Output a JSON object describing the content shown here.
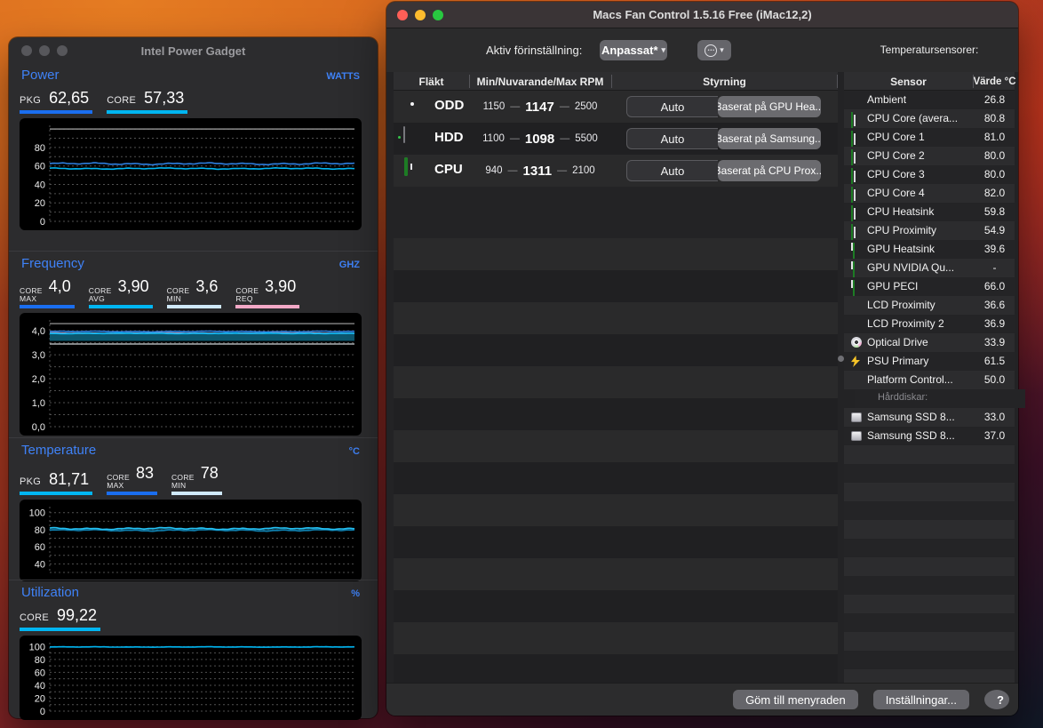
{
  "colors": {
    "accent_blue": "#3f82f7",
    "stat_blue": "#1a6ef0",
    "stat_cyan": "#00b6f2",
    "stat_pale_blue": "#cfe9fa",
    "stat_pink": "#f2a8c6",
    "traffic_red": "#ff5f57",
    "traffic_yellow": "#febc2e",
    "traffic_green": "#28c840"
  },
  "power_gadget": {
    "window_title": "Intel Power Gadget",
    "sections": {
      "power": {
        "title": "Power",
        "unit": "WATTS",
        "stats": [
          {
            "label": "PKG",
            "value": "62,65"
          },
          {
            "label": "CORE",
            "value": "57,33"
          }
        ]
      },
      "frequency": {
        "title": "Frequency",
        "unit": "GHZ",
        "stats": [
          {
            "label_top": "CORE",
            "label_bottom": "MAX",
            "value": "4,0"
          },
          {
            "label_top": "CORE",
            "label_bottom": "AVG",
            "value": "3,90"
          },
          {
            "label_top": "CORE",
            "label_bottom": "MIN",
            "value": "3,6"
          },
          {
            "label_top": "CORE",
            "label_bottom": "REQ",
            "value": "3,90"
          }
        ]
      },
      "temperature": {
        "title": "Temperature",
        "unit": "°C",
        "stats": [
          {
            "label": "PKG",
            "value": "81,71"
          },
          {
            "label_top": "CORE",
            "label_bottom": "MAX",
            "value": "83"
          },
          {
            "label_top": "CORE",
            "label_bottom": "MIN",
            "value": "78"
          }
        ]
      },
      "utilization": {
        "title": "Utilization",
        "unit": "%",
        "stats": [
          {
            "label": "CORE",
            "value": "99,22"
          }
        ]
      }
    }
  },
  "fan_control": {
    "window_title": "Macs Fan Control 1.5.16 Free (iMac12,2)",
    "toolbar": {
      "preset_label": "Aktiv förinställning:",
      "preset_value": "Anpassat*",
      "sensors_title": "Temperatursensorer:"
    },
    "fan_table": {
      "headers": [
        "Fläkt",
        "Min/Nuvarande/Max RPM",
        "Styrning"
      ],
      "rows": [
        {
          "name": "ODD",
          "icon": "optical-disc-icon",
          "min": "1150",
          "current": "1147",
          "max": "2500",
          "auto_label": "Auto",
          "mode_label": "Baserat på GPU Hea..."
        },
        {
          "name": "HDD",
          "icon": "hard-drive-icon",
          "min": "1100",
          "current": "1098",
          "max": "5500",
          "auto_label": "Auto",
          "mode_label": "Baserat på Samsung..."
        },
        {
          "name": "CPU",
          "icon": "cpu-chip-icon",
          "min": "940",
          "current": "1311",
          "max": "2100",
          "auto_label": "Auto",
          "mode_label": "Baserat på CPU Prox..."
        }
      ]
    },
    "sensor_table": {
      "headers": [
        "Sensor",
        "Värde °C"
      ],
      "rows": [
        {
          "icon": "none",
          "name": "Ambient",
          "value": "26.8"
        },
        {
          "icon": "cpu-chip-icon",
          "name": "CPU Core (avera...",
          "value": "80.8"
        },
        {
          "icon": "cpu-chip-icon",
          "name": "CPU Core 1",
          "value": "81.0"
        },
        {
          "icon": "cpu-chip-icon",
          "name": "CPU Core 2",
          "value": "80.0"
        },
        {
          "icon": "cpu-chip-icon",
          "name": "CPU Core 3",
          "value": "80.0"
        },
        {
          "icon": "cpu-chip-icon",
          "name": "CPU Core 4",
          "value": "82.0"
        },
        {
          "icon": "cpu-chip-icon",
          "name": "CPU Heatsink",
          "value": "59.8"
        },
        {
          "icon": "cpu-chip-icon",
          "name": "CPU Proximity",
          "value": "54.9"
        },
        {
          "icon": "gpu-card-icon",
          "name": "GPU Heatsink",
          "value": "39.6"
        },
        {
          "icon": "gpu-card-icon",
          "name": "GPU NVIDIA Qu...",
          "value": "-"
        },
        {
          "icon": "gpu-card-icon",
          "name": "GPU PECI",
          "value": "66.0"
        },
        {
          "icon": "none",
          "name": "LCD Proximity",
          "value": "36.6"
        },
        {
          "icon": "none",
          "name": "LCD Proximity 2",
          "value": "36.9"
        },
        {
          "icon": "optical-disc-icon",
          "name": "Optical Drive",
          "value": "33.9"
        },
        {
          "icon": "lightning-bolt-icon",
          "name": "PSU Primary",
          "value": "61.5"
        },
        {
          "icon": "none",
          "name": "Platform Control...",
          "value": "50.0"
        },
        {
          "icon": "none",
          "name": "Hårddiskar:",
          "value": "",
          "section": true
        },
        {
          "icon": "drive-icon",
          "name": "Samsung SSD 8...",
          "value": "33.0"
        },
        {
          "icon": "drive-icon",
          "name": "Samsung SSD 8...",
          "value": "37.0"
        }
      ]
    },
    "footer": {
      "hide_button": "Göm till menyraden",
      "settings_button": "Inställningar...",
      "help_button": "?"
    }
  },
  "chart_data": [
    {
      "id": "power",
      "type": "line",
      "title": "Power",
      "ylabel": "WATTS",
      "ylim": [
        0,
        104
      ],
      "yticks": [
        0,
        20,
        40,
        60,
        80
      ],
      "grid": true,
      "top_line": 100,
      "legend_position": "none",
      "series": [
        {
          "name": "PKG",
          "color": "#2e7fe0",
          "base": 62.4,
          "amp": 1.2
        },
        {
          "name": "CORE",
          "color": "#00b6f2",
          "base": 57.2,
          "amp": 0.8
        }
      ]
    },
    {
      "id": "frequency",
      "type": "line",
      "title": "Frequency",
      "ylabel": "GHZ",
      "ylim": [
        0,
        4.45
      ],
      "yticks": [
        0,
        1,
        2,
        3,
        4
      ],
      "ytick_labels": [
        "0,0",
        "1,0",
        "2,0",
        "3,0",
        "4,0"
      ],
      "grid": true,
      "top_line": 4.3,
      "legend_position": "none",
      "series": [
        {
          "name": "CORE MAX",
          "color": "#2e7fe0",
          "base": 3.97,
          "amp": 0.02
        },
        {
          "name": "CORE REQ",
          "color": "#f2a8c6",
          "base": 3.9,
          "amp": 0.01
        },
        {
          "name": "CORE AVG",
          "color": "#00b6f2",
          "base": 3.89,
          "amp": 0.015,
          "fill_to": 3.58,
          "fill_color": "rgba(14,92,116,0.95)"
        },
        {
          "name": "CORE MIN",
          "color": "#cfd6da",
          "base": 3.45,
          "amp": 0.0
        }
      ]
    },
    {
      "id": "temperature",
      "type": "line",
      "title": "Temperature",
      "ylabel": "°C",
      "ylim": [
        30,
        107
      ],
      "yticks": [
        40,
        60,
        80,
        100
      ],
      "grid": true,
      "legend_position": "none",
      "series": [
        {
          "name": "CORE band",
          "color": "#0f7fae",
          "base": 79.3,
          "amp": 1.2
        },
        {
          "name": "PKG",
          "color": "#25c1f3",
          "base": 81.4,
          "amp": 1.3,
          "fill_to": 78.8,
          "fill_color": "rgba(12,86,114,0.6)"
        }
      ]
    },
    {
      "id": "utilization",
      "type": "line",
      "title": "Utilization",
      "ylabel": "%",
      "ylim": [
        0,
        106
      ],
      "yticks": [
        0,
        20,
        40,
        60,
        80,
        100
      ],
      "grid": true,
      "legend_position": "none",
      "series": [
        {
          "name": "CORE",
          "color": "#00b6f2",
          "base": 99.3,
          "amp": 0.4
        }
      ]
    }
  ]
}
